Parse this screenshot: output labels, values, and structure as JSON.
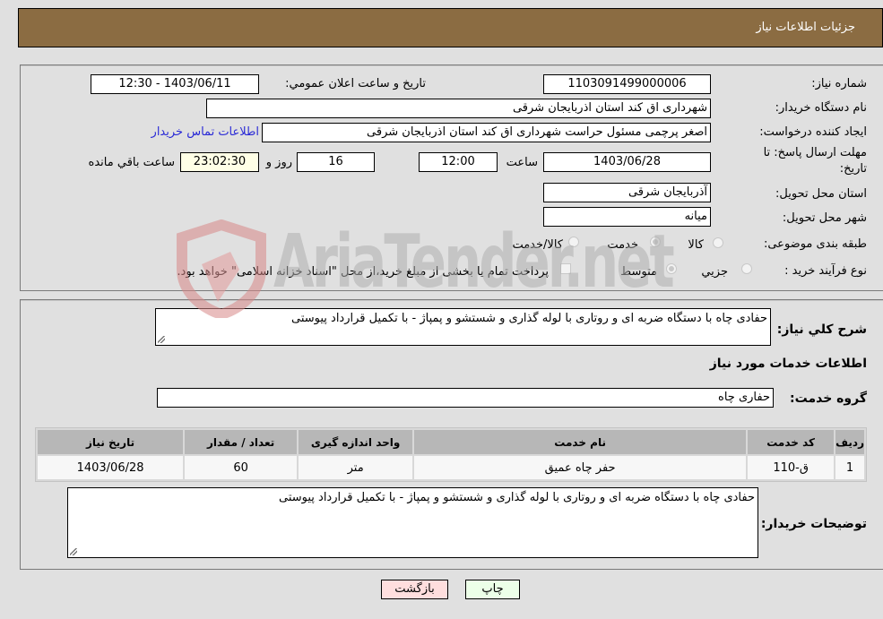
{
  "header": {
    "title": "جزئیات اطلاعات نیاز"
  },
  "details": {
    "need_number": {
      "label": "شماره نیاز:",
      "value": "1103091499000006"
    },
    "announce_datetime": {
      "label": "تاریخ و ساعت اعلان عمومي:",
      "value": "1403/06/11 - 12:30"
    },
    "buyer_org": {
      "label": "نام دستگاه خريدار:",
      "value": "شهرداری اق کند استان اذربایجان شرقی"
    },
    "requester": {
      "label": "ایجاد کننده درخواست:",
      "value": "اصغر پرچمی مسئول حراست شهرداری اق کند استان اذربایجان شرقی"
    },
    "buyer_contact_link": "اطلاعات تماس خریدار",
    "deadline": {
      "label_line1": "مهلت ارسال پاسخ: تا",
      "label_line2": "تاریخ:",
      "date": "1403/06/28",
      "time_label": "ساعت",
      "time": "12:00",
      "days": "16",
      "days_label": "روز و",
      "remaining": "23:02:30",
      "remaining_label": "ساعت باقي مانده"
    },
    "delivery_province": {
      "label": "استان محل تحویل:",
      "value": "آذربایجان شرقی"
    },
    "delivery_city": {
      "label": "شهر محل تحویل:",
      "value": "میانه"
    },
    "category": {
      "label": "طبقه بندی موضوعی:",
      "options": [
        "کالا",
        "خدمت",
        "کالا/خدمت"
      ],
      "selected": "خدمت"
    },
    "purchase_type": {
      "label": "نوع فرآیند خرید :",
      "options": [
        "جزيي",
        "متوسط"
      ],
      "selected": "متوسط",
      "treasury_note": "پرداخت تمام یا بخشی از مبلغ خرید،از محل \"اسناد خزانه اسلامی\" خواهد بود.",
      "treasury_checked": false
    }
  },
  "services": {
    "summary_label": "شرح كلي نياز:",
    "summary_value": "حفادی چاه با دستگاه ضربه ای و روتاری  با لوله گذاری و شستشو و پمپاژ - با تکمیل قرارداد پیوستی",
    "section_title": "اطلاعات خدمات مورد نیاز",
    "group_label": "گروه خدمت:",
    "group_value": "حفاری چاه",
    "table": {
      "columns": [
        "ردیف",
        "کد خدمت",
        "نام خدمت",
        "واحد اندازه گیری",
        "تعداد / مقدار",
        "تاریخ نیاز"
      ],
      "rows": [
        [
          "1",
          "ق-110",
          "حفر چاه عمیق",
          "متر",
          "60",
          "1403/06/28"
        ]
      ]
    },
    "buyer_notes_label": "توضیحات خریدار:",
    "buyer_notes_value": "حفادی چاه با دستگاه ضربه ای و روتاری  با لوله گذاری و شستشو و پمپاژ - با تکمیل قرارداد پیوستی"
  },
  "buttons": {
    "print": "چاپ",
    "back": "بازگشت"
  },
  "watermark": "AriaTender.net",
  "colors": {
    "header_bg": "#8b6c42",
    "back_bg": "#ffdede",
    "print_bg": "#ecffe8",
    "link": "#2a2ad6"
  }
}
